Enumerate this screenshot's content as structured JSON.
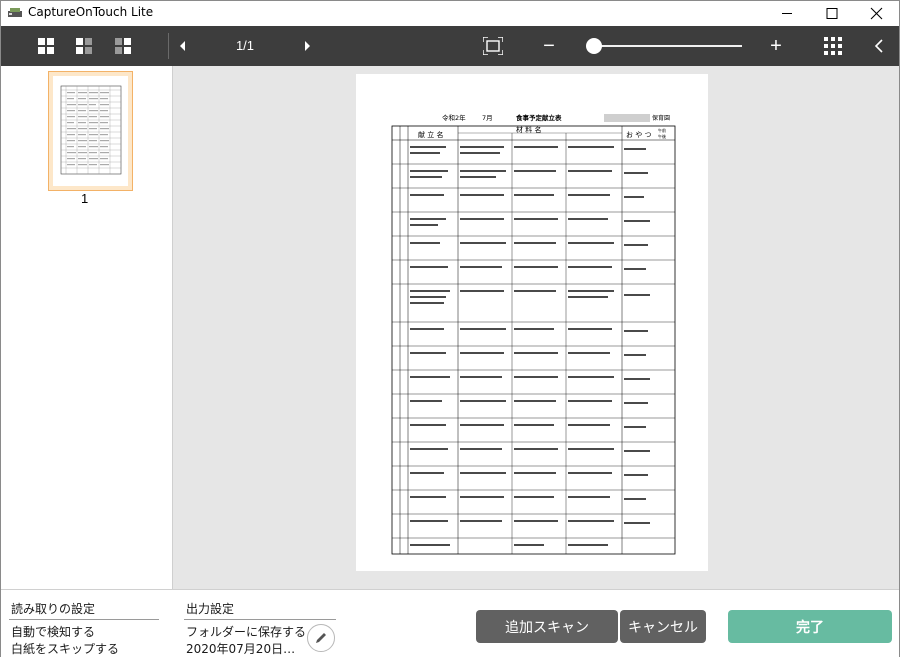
{
  "window": {
    "title": "CaptureOnTouch Lite"
  },
  "toolbar": {
    "page_indicator": "1/1",
    "zoom_minus": "−",
    "zoom_plus": "+",
    "zoom_level_fraction": 0.0
  },
  "thumbnails": [
    {
      "page_number": "1",
      "selected": true
    }
  ],
  "document": {
    "heading_era": "令和2年",
    "heading_month": "7月",
    "heading_title": "食事予定献立表",
    "heading_nursery": "保育園",
    "col_menu": "献 立 名",
    "col_ingredients": "材 料 名",
    "col_snack": "お や つ",
    "col_morning": "午前",
    "col_afternoon": "午後"
  },
  "bottom": {
    "scan_settings": {
      "heading": "読み取りの設定",
      "items": [
        "自動で検知する",
        "白紙をスキップする"
      ]
    },
    "output_settings": {
      "heading": "出力設定",
      "items": [
        "フォルダーに保存する",
        "2020年07月20日…"
      ]
    },
    "buttons": {
      "add_scan": "追加スキャン",
      "cancel": "キャンセル",
      "done": "完了"
    }
  },
  "colors": {
    "toolbar_bg": "#3d3d3d",
    "preview_bg": "#e6e6e6",
    "thumb_selected_border": "#f3b267",
    "done_button": "#67bba1",
    "secondary_button": "#616161"
  }
}
